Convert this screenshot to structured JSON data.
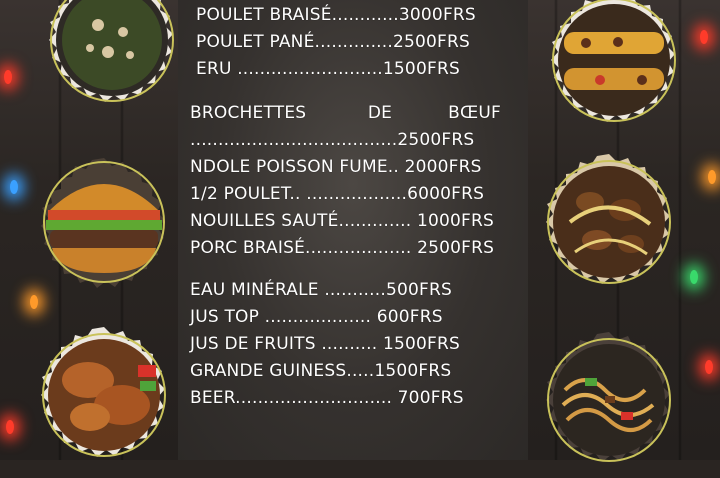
{
  "menu": {
    "groups": [
      {
        "items": [
          {
            "text": "POULET BRAISÉ............3000FRS"
          },
          {
            "text": "POULET PANÉ..............2500FRS"
          },
          {
            "text": "ERU ..........................1500FRS"
          }
        ]
      },
      {
        "items": [
          {
            "text": "BROCHETTES           DE          BŒUF"
          },
          {
            "text": ".....................................2500FRS"
          },
          {
            "text": "NDOLE POISSON FUME.. 2000FRS"
          },
          {
            "text": "1/2 POULET.. ..................6000FRS"
          },
          {
            "text": "NOUILLES SAUTÉ............. 1000FRS"
          },
          {
            "text": "PORC BRAISÉ................... 2500FRS"
          }
        ]
      },
      {
        "items": [
          {
            "text": "EAU MINÉRALE ...........500FRS"
          },
          {
            "text": "JUS TOP ................... 600FRS"
          },
          {
            "text": "JUS DE FRUITS .......... 1500FRS"
          },
          {
            "text": "GRANDE GUINESS.....1500FRS"
          },
          {
            "text": "BEER............................ 700FRS"
          }
        ]
      }
    ]
  },
  "dishes": [
    {
      "icon": "eru-plate-icon"
    },
    {
      "icon": "burger-icon"
    },
    {
      "icon": "grilled-chicken-icon"
    },
    {
      "icon": "wrap-icon"
    },
    {
      "icon": "brochettes-icon"
    },
    {
      "icon": "noodles-icon"
    }
  ],
  "colors": {
    "text": "#ffffff",
    "badge_ring": "#c9c25a",
    "badge_edge": "#e9e4dc",
    "light_red": "#ff3b2a",
    "light_orange": "#ff9a2a",
    "light_blue": "#3aa0ff",
    "light_green": "#39d96b"
  }
}
